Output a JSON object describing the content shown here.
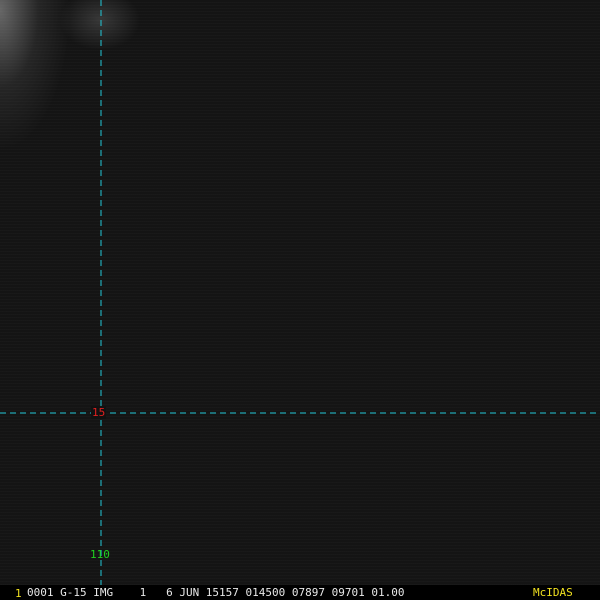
{
  "colors": {
    "background": "#111111",
    "grid_line": "#22c8d8",
    "latitude_label": "#e02020",
    "longitude_label": "#20d020",
    "frame_number": "#f0e020",
    "status_text": "#e8e8e8",
    "brand": "#f0e020"
  },
  "grid": {
    "latitude_label": "15",
    "longitude_label": "110"
  },
  "status_bar": {
    "frame_number": "1",
    "text": "0001 G-15 IMG    1   6 JUN 15157 014500 07897 09701 01.00",
    "brand": "McIDAS"
  }
}
